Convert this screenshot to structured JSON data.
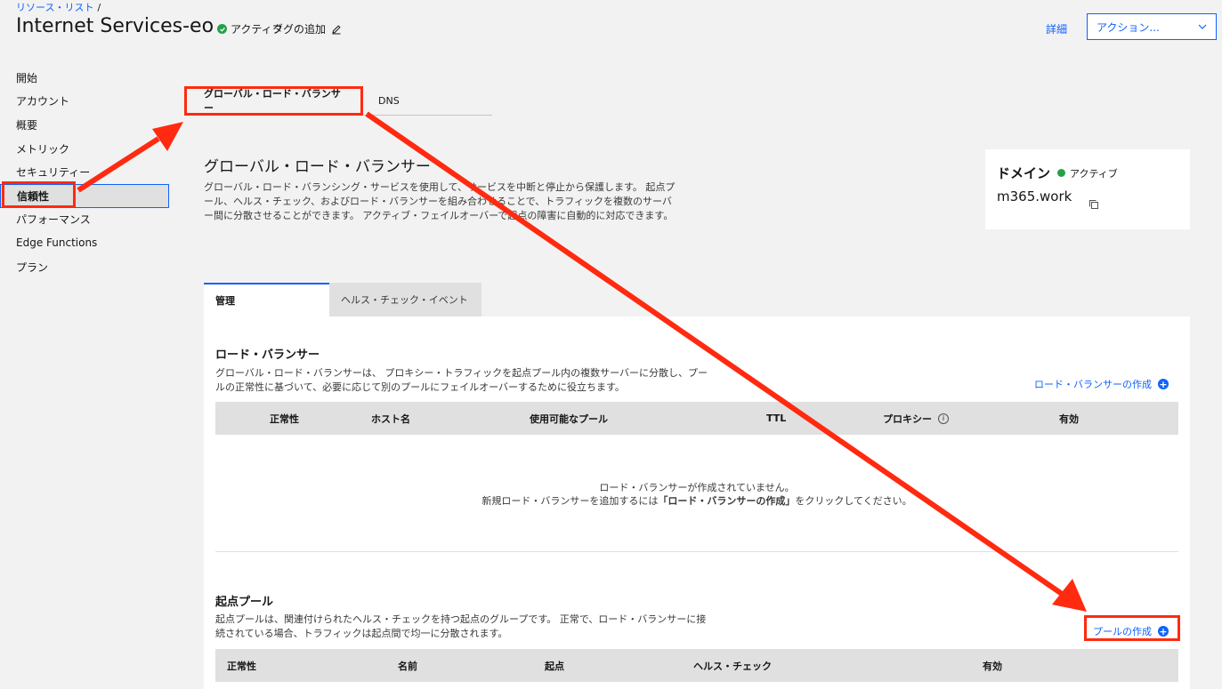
{
  "breadcrumb": {
    "link": "リソース・リスト",
    "separator": "/"
  },
  "header": {
    "title": "Internet Services-eo",
    "status": "アクティブ",
    "add_tag": "タグの追加",
    "details": "詳細",
    "actions": "アクション..."
  },
  "sidebar": {
    "items": [
      {
        "label": "開始"
      },
      {
        "label": "アカウント"
      },
      {
        "label": "概要"
      },
      {
        "label": "メトリック"
      },
      {
        "label": "セキュリティー"
      },
      {
        "label": "信頼性"
      },
      {
        "label": "パフォーマンス"
      },
      {
        "label": "Edge Functions"
      },
      {
        "label": "プラン"
      }
    ]
  },
  "top_tabs": {
    "glb": "グローバル・ロード・バランサー",
    "dns": "DNS"
  },
  "main": {
    "title": "グローバル・ロード・バランサー",
    "description": "グローバル・ロード・バランシング・サービスを使用して、サービスを中断と停止から保護します。 起点プール、ヘルス・チェック、およびロード・バランサーを組み合わせることで、トラフィックを複数のサーバー間に分散させることができます。 アクティブ・フェイルオーバーで起点の障害に自動的に対応できます。"
  },
  "domain_card": {
    "label": "ドメイン",
    "status": "アクティブ",
    "name": "m365.work"
  },
  "sub_tabs": {
    "manage": "管理",
    "health_events": "ヘルス・チェック・イベント"
  },
  "load_balancers": {
    "title": "ロード・バランサー",
    "description": "グローバル・ロード・バランサーは、 プロキシー・トラフィックを起点プール内の複数サーバーに分散し、プールの正常性に基づいて、必要に応じて別のプールにフェイルオーバーするために役立ちます。",
    "create": "ロード・バランサーの作成",
    "columns": {
      "health": "正常性",
      "hostname": "ホスト名",
      "pools": "使用可能なプール",
      "ttl": "TTL",
      "proxy": "プロキシー",
      "enabled": "有効"
    },
    "empty_line1": "ロード・バランサーが作成されていません。",
    "empty_pre": "新規ロード・バランサーを追加するには",
    "empty_bold": "「ロード・バランサーの作成」",
    "empty_post": "をクリックしてください。"
  },
  "origin_pools": {
    "title": "起点プール",
    "description": "起点プールは、関連付けられたヘルス・チェックを持つ起点のグループです。 正常で、ロード・バランサーに接続されている場合、トラフィックは起点間で均一に分散されます。",
    "create": "プールの作成",
    "columns": {
      "health": "正常性",
      "name": "名前",
      "origins": "起点",
      "health_check": "ヘルス・チェック",
      "enabled": "有効"
    }
  },
  "colors": {
    "accent": "#0f62fe",
    "annotation": "#ff2a10",
    "ok": "#24a148"
  }
}
